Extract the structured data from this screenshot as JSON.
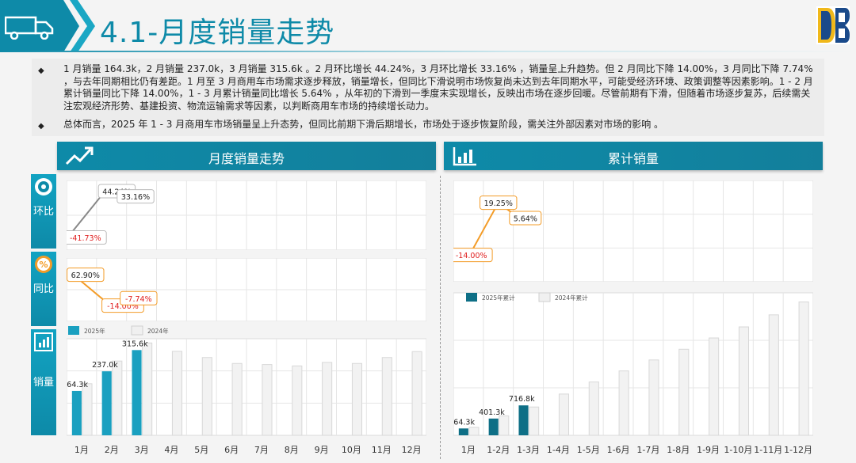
{
  "header": {
    "title": "4.1-月度销量走势"
  },
  "bullets": [
    "1 月销量 164.3k，2 月销量 237.0k，3 月销量 315.6k 。2 月环比增长 44.24%，3 月环比增长 33.16% ，销量呈上升趋势。但 2 月同比下降 14.00%，3 月同比下降 7.74% ，与去年同期相比仍有差距。1 月至 3 月商用车市场需求逐步释放，销量增长，但同比下滑说明市场恢复尚未达到去年同期水平，可能受经济环境、政策调整等因素影响。1 - 2 月累计销量同比下降 14.00%，1 - 3 月累计销量同比增长 5.64% ，从年初的下滑到一季度末实现增长，反映出市场在逐步回暖。尽管前期有下滑，但随着市场逐步复苏，后续需关注宏观经济形势、基建投资、物流运输需求等因素，以判断商用车市场的持续增长动力。",
    "总体而言，2025 年 1 - 3 月商用车市场销量呈上升态势，但同比前期下滑后期增长，市场处于逐步恢复阶段，需关注外部因素对市场的影响 。"
  ],
  "left_panel": {
    "title": "月度销量走势",
    "tabs": {
      "mom": "环比",
      "yoy": "同比",
      "sales": "销量"
    }
  },
  "right_panel": {
    "title": "累计销量"
  },
  "colors": {
    "primary": "#0e8aa8",
    "accent_orange": "#f39c28",
    "negative": "#e02020",
    "bar_2024": "#efefef"
  },
  "chart_data": [
    {
      "type": "line",
      "name": "环比",
      "categories": [
        "1月",
        "2月",
        "3月",
        "4月",
        "5月",
        "6月",
        "7月",
        "8月",
        "9月",
        "10月",
        "11月",
        "12月"
      ],
      "series": [
        {
          "values": [
            -41.73,
            44.24,
            33.16
          ]
        }
      ],
      "labels": [
        "-41.73%",
        "44.24%",
        "33.16%"
      ],
      "color": "#888888"
    },
    {
      "type": "line",
      "name": "同比",
      "categories": [
        "1月",
        "2月",
        "3月",
        "4月",
        "5月",
        "6月",
        "7月",
        "8月",
        "9月",
        "10月",
        "11月",
        "12月"
      ],
      "series": [
        {
          "values": [
            62.9,
            -14.0,
            -7.74
          ]
        }
      ],
      "labels": [
        "62.90%",
        "-14.00%",
        "-7.74%"
      ],
      "color": "#f39c28"
    },
    {
      "type": "bar",
      "name": "销量",
      "categories": [
        "1月",
        "2月",
        "3月",
        "4月",
        "5月",
        "6月",
        "7月",
        "8月",
        "9月",
        "10月",
        "11月",
        "12月"
      ],
      "legend": [
        "2025年",
        "2024年"
      ],
      "series": [
        {
          "name": "2025年",
          "values": [
            164.3,
            237.0,
            315.6
          ]
        },
        {
          "name": "2024年",
          "values": [
            191,
            275,
            342,
            311,
            288,
            266,
            262,
            257,
            270,
            266,
            288,
            310
          ]
        }
      ],
      "labels": [
        "164.3k",
        "237.0k",
        "315.6k"
      ]
    },
    {
      "type": "line",
      "name": "累计同比",
      "categories": [
        "1-2月",
        "1-3月"
      ],
      "series": [
        {
          "values": [
            -14.0,
            19.25,
            5.64
          ]
        }
      ],
      "labels": [
        "-14.00%",
        "19.25%",
        "5.64%"
      ],
      "color": "#f39c28"
    },
    {
      "type": "bar",
      "name": "累计销量",
      "categories": [
        "1月",
        "1-2月",
        "1-3月",
        "1-4月",
        "1-5月",
        "1-6月",
        "1-7月",
        "1-8月",
        "1-9月",
        "1-10月",
        "1-11月",
        "1-12月"
      ],
      "legend": [
        "2025年累计",
        "2024年累计"
      ],
      "series": [
        {
          "name": "2025年累计",
          "values": [
            164.3,
            401.3,
            716.8
          ]
        },
        {
          "name": "2024年累计",
          "values": [
            191,
            466,
            678,
            989,
            1277,
            1543,
            1805,
            2062,
            2332,
            2598,
            2886,
            3196
          ]
        }
      ],
      "labels": [
        "164.3k",
        "401.3k",
        "716.8k"
      ]
    }
  ]
}
